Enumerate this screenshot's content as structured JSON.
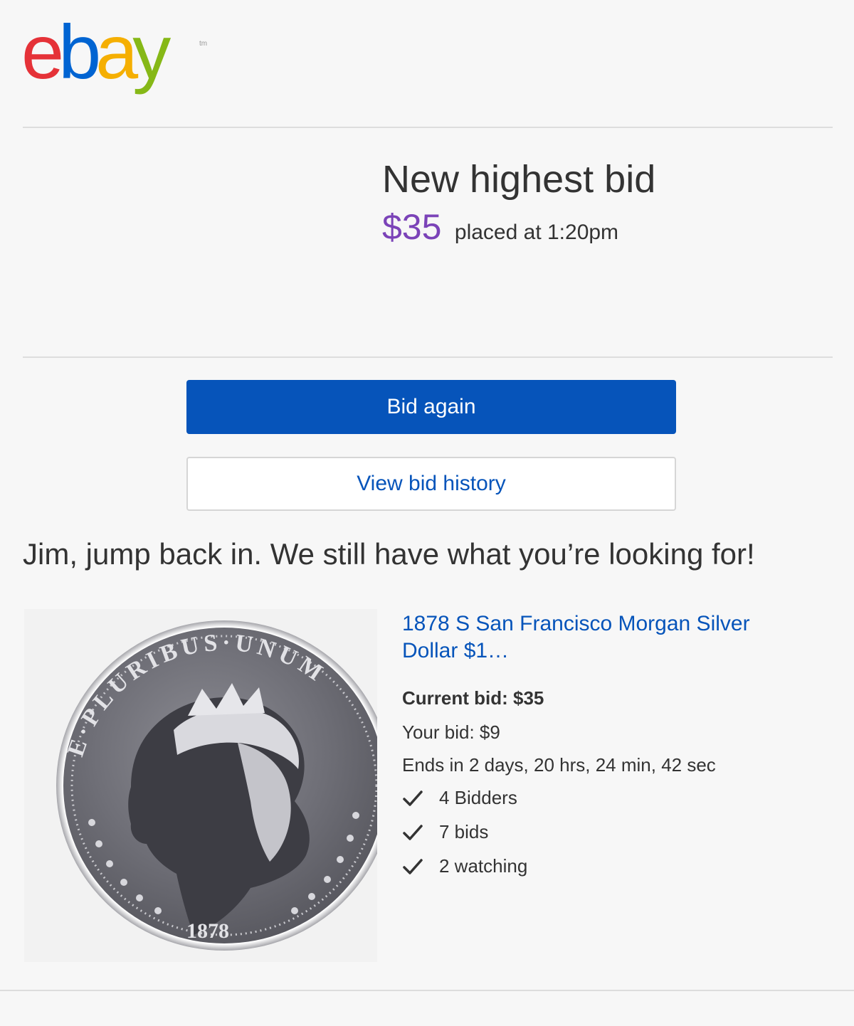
{
  "brand": {
    "logo_letters": [
      "e",
      "b",
      "a",
      "y"
    ],
    "trademark": "tm",
    "colors": {
      "e": "#e53238",
      "b": "#0064d2",
      "a": "#f5af02",
      "y": "#86b817"
    }
  },
  "notification": {
    "headline": "New highest bid",
    "amount": "$35",
    "time_text": "placed at 1:20pm"
  },
  "actions": {
    "primary_label": "Bid again",
    "secondary_label": "View bid history"
  },
  "promo": {
    "message": "Jim, jump back in. We still have what you’re looking for!"
  },
  "item": {
    "image_icon": "morgan-silver-dollar-coin-image",
    "coin_year": "1878",
    "coin_legend": "E·PLURIBUS·UNUM",
    "title": "1878 S San Francisco Morgan Silver Dollar $1…",
    "current_bid": "Current bid: $35",
    "your_bid": "Your bid: $9",
    "ends_in": "Ends in 2 days, 20 hrs, 24 min, 42 sec",
    "stats": [
      {
        "icon": "checkmark-icon",
        "label": "4 Bidders"
      },
      {
        "icon": "checkmark-icon",
        "label": "7 bids"
      },
      {
        "icon": "checkmark-icon",
        "label": "2 watching"
      }
    ]
  },
  "theme": {
    "accent_blue": "#0654ba",
    "bid_purple": "#7b43b8",
    "background": "#f7f7f7",
    "divider": "#dddddd"
  }
}
